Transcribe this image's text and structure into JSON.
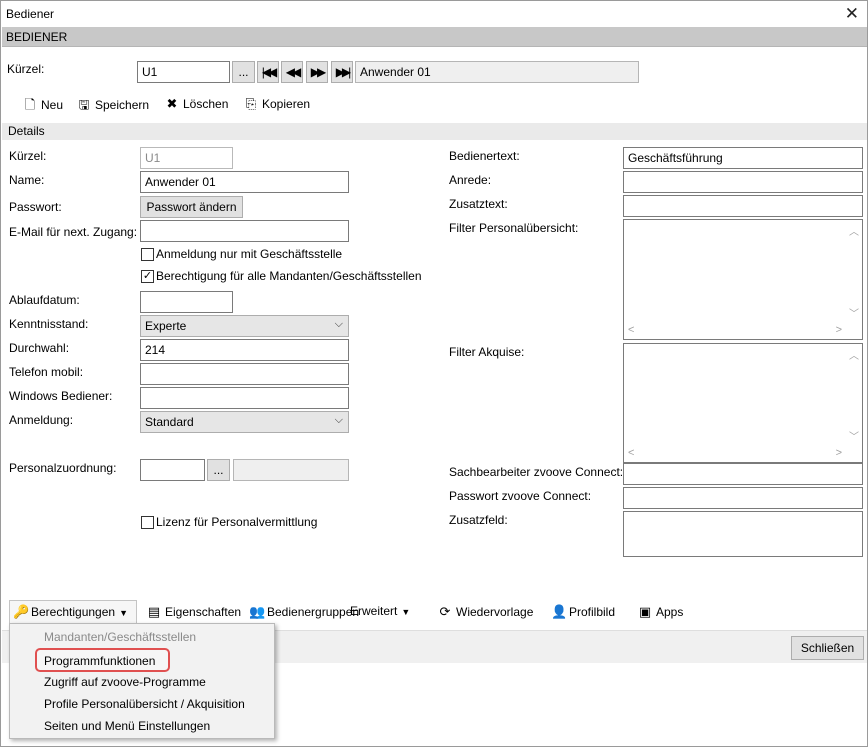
{
  "window": {
    "title": "Bediener",
    "close_icon": "close-icon"
  },
  "section_title": "BEDIENER",
  "top": {
    "kuerzel_label": "Kürzel:",
    "kuerzel_value": "U1",
    "browse_label": "...",
    "nav": {
      "first": "|◀◀",
      "prev": "◀◀",
      "next": "▶▶",
      "last": "▶▶|"
    },
    "user_name_display": "Anwender 01"
  },
  "toolbar": {
    "neu": "Neu",
    "speichern": "Speichern",
    "loeschen": "Löschen",
    "kopieren": "Kopieren"
  },
  "details_label": "Details",
  "left_form": {
    "kuerzel_label": "Kürzel:",
    "kuerzel_value": "U1",
    "name_label": "Name:",
    "name_value": "Anwender 01",
    "passwort_label": "Passwort:",
    "passwort_button": "Passwort ändern",
    "email_label": "E-Mail für next. Zugang:",
    "email_value": "",
    "chk_anmeldung_label": "Anmeldung nur mit Geschäftsstelle",
    "chk_anmeldung_checked": false,
    "chk_berechtigung_label": "Berechtigung für alle Mandanten/Geschäftsstellen",
    "chk_berechtigung_checked": true,
    "ablaufdatum_label": "Ablaufdatum:",
    "ablaufdatum_value": "",
    "kenntnisstand_label": "Kenntnisstand:",
    "kenntnisstand_value": "Experte",
    "durchwahl_label": "Durchwahl:",
    "durchwahl_value": "214",
    "telefon_label": "Telefon mobil:",
    "telefon_value": "",
    "windows_label": "Windows Bediener:",
    "windows_value": "",
    "anmeldung_label": "Anmeldung:",
    "anmeldung_value": "Standard",
    "personalzuordnung_label": "Personalzuordnung:",
    "personalzuordnung_value": "",
    "personalzuordnung_browse": "...",
    "chk_lizenz_label": "Lizenz für Personalvermittlung",
    "chk_lizenz_checked": false
  },
  "right_form": {
    "bedienertext_label": "Bedienertext:",
    "bedienertext_value": "Geschäftsführung",
    "anrede_label": "Anrede:",
    "anrede_value": "",
    "zusatztext_label": "Zusatztext:",
    "zusatztext_value": "",
    "filter_personal_label": "Filter Personalübersicht:",
    "filter_akquise_label": "Filter Akquise:",
    "sachbearbeiter_label": "Sachbearbeiter zvoove Connect:",
    "sachbearbeiter_value": "",
    "passwort_connect_label": "Passwort zvoove Connect:",
    "passwort_connect_value": "",
    "zusatzfeld_label": "Zusatzfeld:"
  },
  "bottom_toolbar": {
    "berechtigungen": "Berechtigungen",
    "eigenschaften": "Eigenschaften",
    "bedienergruppen": "Bedienergruppen",
    "erweitert": "Erweitert",
    "wiedervorlage": "Wiedervorlage",
    "profilbild": "Profilbild",
    "apps": "Apps"
  },
  "footer": {
    "schliessen": "Schließen"
  },
  "dropdown_menu": [
    {
      "label": "Mandanten/Geschäftsstellen",
      "enabled": false
    },
    {
      "label": "Programmfunktionen",
      "enabled": true,
      "highlighted": true
    },
    {
      "label": "Zugriff auf zvoove-Programme",
      "enabled": true
    },
    {
      "label": "Profile Personalübersicht / Akquisition",
      "enabled": true
    },
    {
      "label": "Seiten und Menü Einstellungen",
      "enabled": true
    }
  ],
  "colors": {
    "section_bar": "#c8c8c8",
    "highlight_border": "#e05050",
    "menu_bg": "#f2f2f2"
  }
}
